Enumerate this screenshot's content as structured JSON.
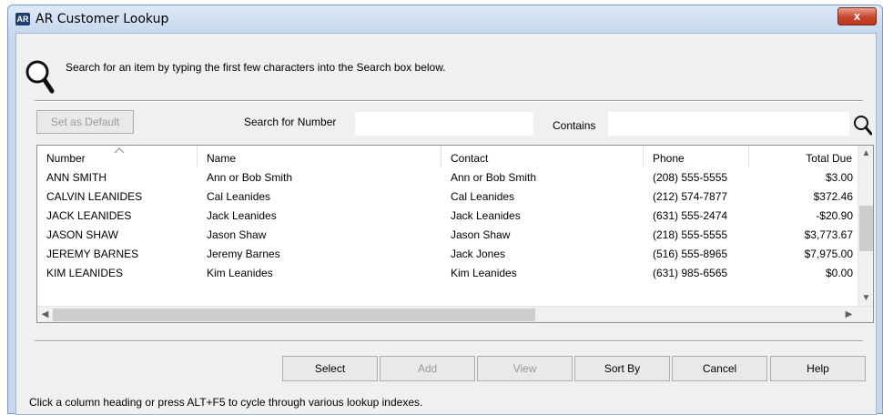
{
  "window": {
    "app_icon": "AR",
    "title": "AR Customer Lookup",
    "close_glyph": "x"
  },
  "instructions": "Search for an item by typing the first few characters into the Search box below.",
  "toolbar": {
    "set_default_label": "Set as Default",
    "search_label": "Search for Number",
    "search_value": "",
    "contains_label": "Contains",
    "contains_value": ""
  },
  "grid": {
    "columns": [
      "Number",
      "Name",
      "Contact",
      "Phone",
      "Total Due"
    ],
    "rows": [
      [
        "ANN SMITH",
        "Ann or Bob Smith",
        "Ann or Bob Smith",
        "(208) 555-5555",
        "$3.00"
      ],
      [
        "CALVIN LEANIDES",
        "Cal Leanides",
        "Cal Leanides",
        "(212) 574-7877",
        "$372.46"
      ],
      [
        "JACK LEANIDES",
        "Jack Leanides",
        "Jack Leanides",
        "(631) 555-2474",
        "-$20.90"
      ],
      [
        "JASON SHAW",
        "Jason Shaw",
        "Jason Shaw",
        "(218) 555-5555",
        "$3,773.67"
      ],
      [
        "JEREMY BARNES",
        "Jeremy Barnes",
        "Jack Jones",
        "(516) 555-8965",
        "$7,975.00"
      ],
      [
        "KIM LEANIDES",
        "Kim Leanides",
        "Kim Leanides",
        "(631) 985-6565",
        "$0.00"
      ]
    ]
  },
  "buttons": {
    "select": "Select",
    "add": "Add",
    "view": "View",
    "sort_by": "Sort By",
    "cancel": "Cancel",
    "help": "Help"
  },
  "status_text": "Click a column heading or press ALT+F5 to cycle through various lookup indexes.",
  "icons": {
    "app": "ar-app-icon",
    "close": "close-icon",
    "magnifier": "magnifier-icon",
    "search": "search-icon",
    "sort": "sort-ascending-icon"
  },
  "colors": {
    "title_bar": "#c6d8ee",
    "close_button": "#c7452b",
    "dialog_bg": "#f0f0f0"
  }
}
